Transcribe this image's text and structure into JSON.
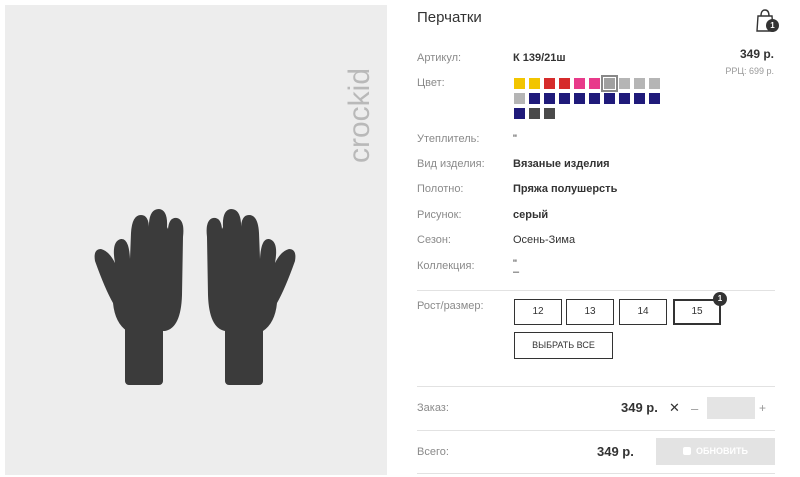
{
  "product": {
    "title": "Перчатки",
    "brand_logo": "crockid",
    "price": "349 р.",
    "rrp": "РРЦ: 699 р."
  },
  "cart": {
    "icon": "bag-icon",
    "count": "1"
  },
  "fields": {
    "article_label": "Артикул:",
    "article_value": "К 139/21ш",
    "color_label": "Цвет:",
    "insulation_label": "Утеплитель:",
    "insulation_value": "\"",
    "type_label": "Вид изделия:",
    "type_value": "Вязаные изделия",
    "fabric_label": "Полотно:",
    "fabric_value": "Пряжа полушерсть",
    "pattern_label": "Рисунок:",
    "pattern_value": "серый",
    "season_label": "Сезон:",
    "season_value": "Осень-Зима",
    "collection_label": "Коллекция:",
    "collection_value_1": "\"",
    "collection_value_2": "–"
  },
  "colors": [
    "#f2c500",
    "#f2c500",
    "#d62b2b",
    "#d62b2b",
    "#e83a8a",
    "#e83a8a",
    "#a0a0a0",
    "#b5b5b5",
    "#b5b5b5",
    "#b5b5b5",
    "#b5b5b5",
    "#1f1a7a",
    "#1f1a7a",
    "#1f1a7a",
    "#1f1a7a",
    "#1f1a7a",
    "#1f1a7a",
    "#1f1a7a",
    "#1f1a7a",
    "#1f1a7a",
    "#1f1a7a",
    "#4a4a4a",
    "#4a4a4a"
  ],
  "selected_color_index": 6,
  "sizes": {
    "label": "Рост/размер:",
    "options": [
      "12",
      "13",
      "14",
      "15"
    ],
    "active": "15",
    "badge": "1",
    "select_all": "ВЫБРАТЬ ВСЕ"
  },
  "order": {
    "label": "Заказ:",
    "price": "349 р.",
    "times": "✕",
    "minus": "–",
    "plus": "+",
    "quantity": ""
  },
  "total": {
    "label": "Всего:",
    "price": "349 р.",
    "update_button": "ОБНОВИТЬ"
  },
  "theme": {
    "glove_color": "#3b3b3b",
    "panel_bg": "#ededed",
    "logo_color": "#b9b9b9"
  }
}
